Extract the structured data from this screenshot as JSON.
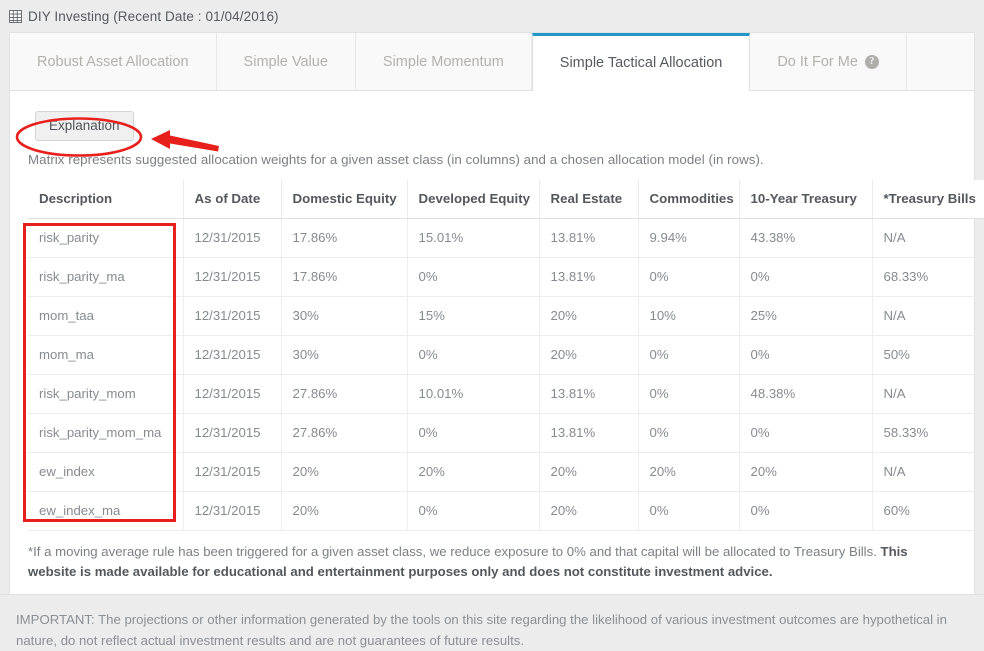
{
  "header": {
    "icon": "grid-table-icon",
    "title": "DIY Investing (Recent Date : 01/04/2016)"
  },
  "tabs": [
    {
      "label": "Robust Asset Allocation",
      "active": false,
      "help": false
    },
    {
      "label": "Simple Value",
      "active": false,
      "help": false
    },
    {
      "label": "Simple Momentum",
      "active": false,
      "help": false
    },
    {
      "label": "Simple Tactical Allocation",
      "active": true,
      "help": false
    },
    {
      "label": "Do It For Me",
      "active": false,
      "help": true,
      "help_icon": "question-circle-icon"
    }
  ],
  "body": {
    "explanation_button": "Explanation",
    "intro": "Matrix represents suggested allocation weights for a given asset class (in columns) and a chosen allocation model (in rows).",
    "footnote_normal": "*If a moving average rule has been triggered for a given asset class, we reduce exposure to 0% and that capital will be allocated to Treasury Bills. ",
    "footnote_bold": "This website is made available for educational and entertainment purposes only and does not constitute investment advice."
  },
  "table": {
    "headers": [
      "Description",
      "As of Date",
      "Domestic Equity",
      "Developed Equity",
      "Real Estate",
      "Commodities",
      "10-Year Treasury",
      "*Treasury Bills"
    ],
    "rows": [
      [
        "risk_parity",
        "12/31/2015",
        "17.86%",
        "15.01%",
        "13.81%",
        "9.94%",
        "43.38%",
        "N/A"
      ],
      [
        "risk_parity_ma",
        "12/31/2015",
        "17.86%",
        "0%",
        "13.81%",
        "0%",
        "0%",
        "68.33%"
      ],
      [
        "mom_taa",
        "12/31/2015",
        "30%",
        "15%",
        "20%",
        "10%",
        "25%",
        "N/A"
      ],
      [
        "mom_ma",
        "12/31/2015",
        "30%",
        "0%",
        "20%",
        "0%",
        "0%",
        "50%"
      ],
      [
        "risk_parity_mom",
        "12/31/2015",
        "27.86%",
        "10.01%",
        "13.81%",
        "0%",
        "48.38%",
        "N/A"
      ],
      [
        "risk_parity_mom_ma",
        "12/31/2015",
        "27.86%",
        "0%",
        "13.81%",
        "0%",
        "0%",
        "58.33%"
      ],
      [
        "ew_index",
        "12/31/2015",
        "20%",
        "20%",
        "20%",
        "20%",
        "20%",
        "N/A"
      ],
      [
        "ew_index_ma",
        "12/31/2015",
        "20%",
        "0%",
        "20%",
        "0%",
        "0%",
        "60%"
      ]
    ]
  },
  "disclaimer": "IMPORTANT: The projections or other information generated by the tools on this site regarding the likelihood of various investment outcomes are hypothetical in nature, do not reflect actual investment results and are not guarantees of future results.",
  "annotations": {
    "ellipse_around": "Explanation",
    "arrow_points_to": "Explanation",
    "box_around": "Description column",
    "color": "#e8201c"
  },
  "colors": {
    "active_tab_accent": "#2196c9",
    "annotation_red": "#e8201c",
    "page_background": "#ececec",
    "panel_background": "#ffffff"
  }
}
